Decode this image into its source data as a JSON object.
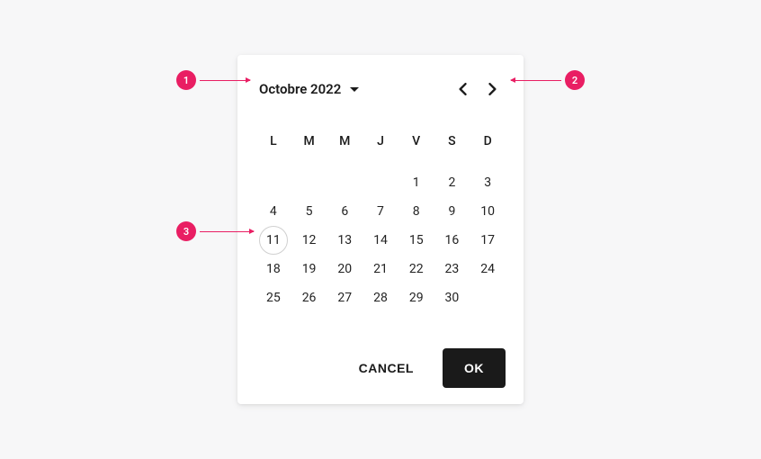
{
  "header": {
    "month_label": "Octobre 2022"
  },
  "weekdays": [
    "L",
    "M",
    "M",
    "J",
    "V",
    "S",
    "D"
  ],
  "calendar": {
    "leading_blanks": 4,
    "days_in_month": 30,
    "today": 11
  },
  "actions": {
    "cancel_label": "CANCEL",
    "ok_label": "OK"
  },
  "annotations": {
    "a1": "1",
    "a2": "2",
    "a3": "3"
  }
}
